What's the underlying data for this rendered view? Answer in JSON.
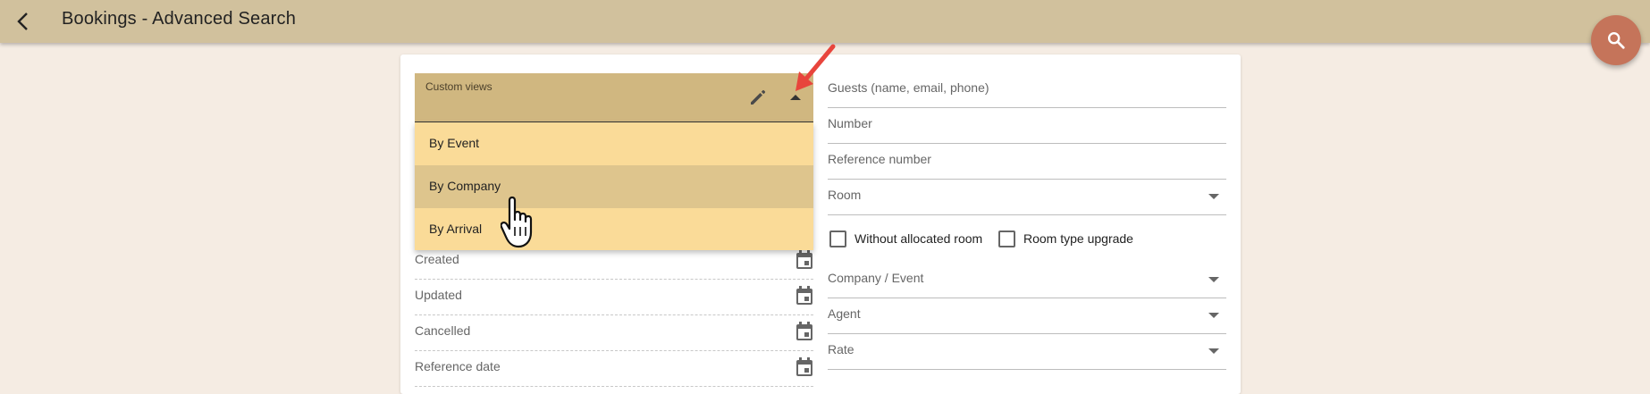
{
  "header": {
    "title": "Bookings - Advanced Search",
    "back_icon": "chevron-left-icon",
    "bar_color": "#d1c19d"
  },
  "fab": {
    "icon": "search-icon",
    "color": "#c5745a"
  },
  "custom_views": {
    "label": "Custom views",
    "edit_icon": "pencil-icon",
    "expanded": true,
    "options": [
      "By Event",
      "By Company",
      "By Arrival"
    ],
    "highlighted": "By Company"
  },
  "left_fields": [
    {
      "label": "Created",
      "icon": "calendar-icon"
    },
    {
      "label": "Updated",
      "icon": "calendar-icon"
    },
    {
      "label": "Cancelled",
      "icon": "calendar-icon"
    },
    {
      "label": "Reference date",
      "icon": "calendar-icon"
    }
  ],
  "right_fields": {
    "guests": "Guests (name, email, phone)",
    "number": "Number",
    "reference_number": "Reference number",
    "room": "Room",
    "without_allocated_room": "Without allocated room",
    "room_type_upgrade": "Room type upgrade",
    "company_event": "Company / Event",
    "agent": "Agent",
    "rate": "Rate"
  },
  "colors": {
    "background": "#f5ece3",
    "dropdown_header": "#d0b780",
    "menu": "#fadb98",
    "menu_hover": "#dec58d",
    "annotation_arrow": "#e8453c"
  }
}
